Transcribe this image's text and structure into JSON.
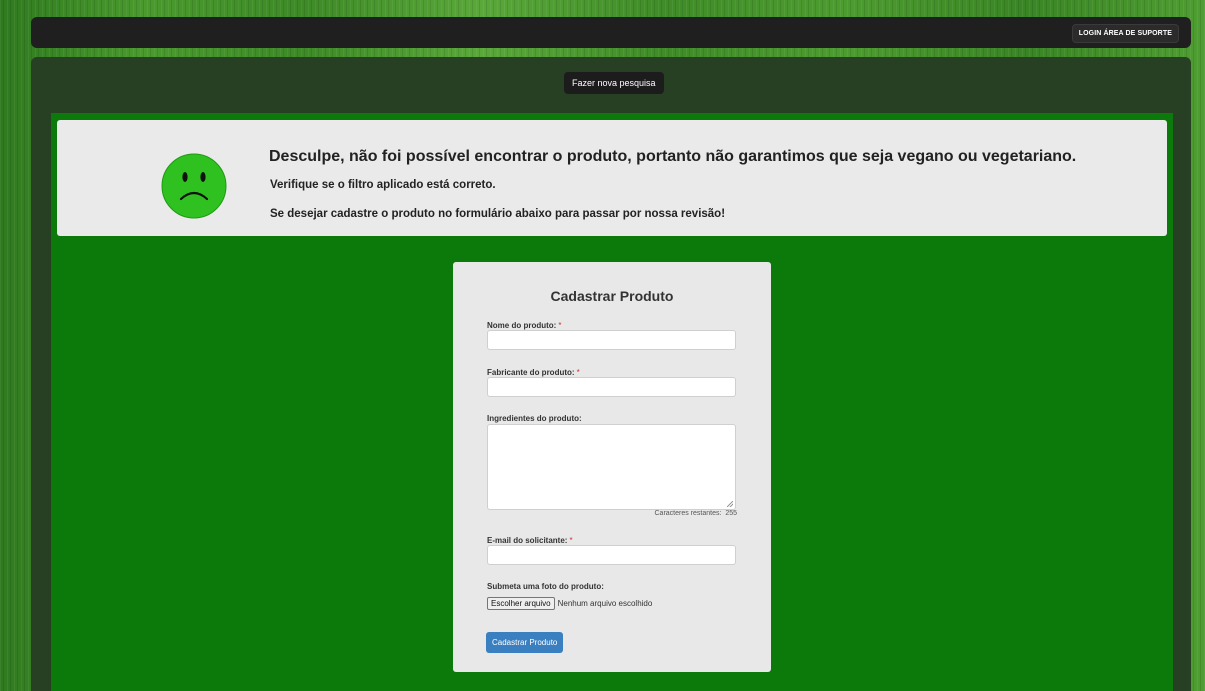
{
  "header": {
    "login_label": "LOGIN ÁREA DE SUPORTE"
  },
  "main": {
    "search_again_label": "Fazer nova pesquisa"
  },
  "alert": {
    "title": "Desculpe, não foi possível encontrar o produto, portanto não garantimos que seja vegano ou vegetariano.",
    "line1": "Verifique se o filtro aplicado está correto.",
    "line2": "Se desejar cadastre o produto no formulário abaixo para passar por nossa revisão!",
    "icon": "sad-face-icon",
    "icon_color": "#2ec11f"
  },
  "form": {
    "title": "Cadastrar Produto",
    "required_marker": "*",
    "name_label": "Nome do produto:",
    "name_value": "",
    "manufacturer_label": "Fabricante do produto:",
    "manufacturer_value": "",
    "ingredients_label": "Ingredientes do produto:",
    "ingredients_value": "",
    "chars_remaining_label": "Caracteres restantes:",
    "chars_remaining_value": "255",
    "email_label": "E-mail do solicitante:",
    "email_value": "",
    "photo_label": "Submeta uma foto do produto:",
    "file_button_label": "Escolher arquivo",
    "file_status": "Nenhum arquivo escolhido",
    "submit_label": "Cadastrar Produto"
  },
  "colors": {
    "page_green": "#0b7a0b",
    "panel_dark": "#273f22",
    "topbar": "#1f1f1f",
    "submit_blue": "#3a7fc0"
  }
}
